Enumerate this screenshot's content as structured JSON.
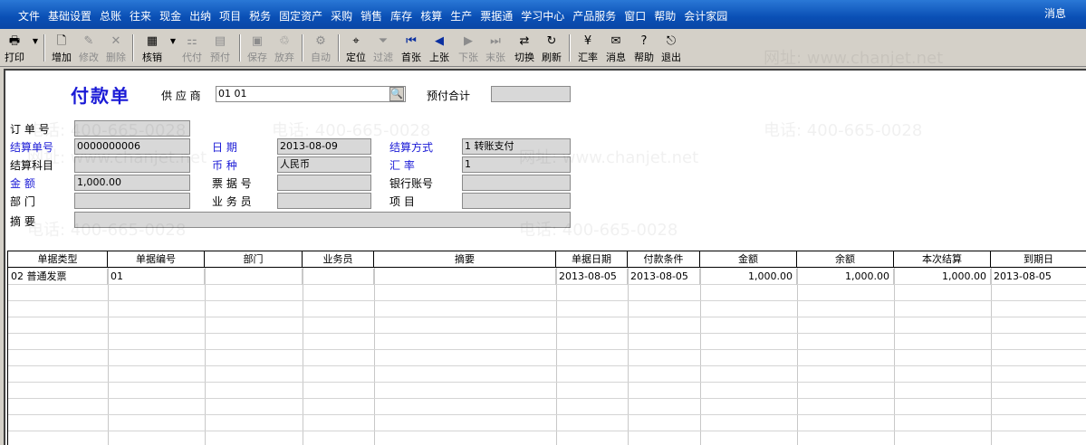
{
  "menubar": {
    "items": [
      "文件",
      "基础设置",
      "总账",
      "往来",
      "现金",
      "出纳",
      "项目",
      "税务",
      "固定资产",
      "采购",
      "销售",
      "库存",
      "核算",
      "生产",
      "票据通",
      "学习中心",
      "产品服务",
      "窗口",
      "帮助",
      "会计家园"
    ],
    "right_label": "消息"
  },
  "toolbar": {
    "print": "打印",
    "add": "增加",
    "edit": "修改",
    "delete": "删除",
    "verify": "核销",
    "proxy": "代付",
    "prepay": "预付",
    "save": "保存",
    "discard": "放弃",
    "auto": "自动",
    "locate": "定位",
    "filter": "过滤",
    "first": "首张",
    "prev": "上张",
    "next": "下张",
    "last": "末张",
    "switch": "切换",
    "refresh": "刷新",
    "rate": "汇率",
    "message": "消息",
    "help": "帮助",
    "exit": "退出"
  },
  "form": {
    "title": "付款单",
    "supplier_label": "供 应 商",
    "supplier_value": "01   01",
    "prepay_total_label": "预付合计",
    "order_no_label": "订 单 号",
    "settle_no_label": "结算单号",
    "settle_no_value": "0000000006",
    "date_label": "日    期",
    "date_value": "2013-08-09",
    "settle_method_label": "结算方式",
    "settle_method_value": "1   转账支付",
    "settle_subject_label": "结算科目",
    "currency_label": "币    种",
    "currency_value": "人民币",
    "exchange_rate_label": "汇    率",
    "exchange_rate_value": "1",
    "amount_label": "金    额",
    "amount_value": "1,000.00",
    "bill_no_label": "票 据 号",
    "bank_account_label": "银行账号",
    "dept_label": "部    门",
    "salesman_label": "业 务 员",
    "project_label": "项    目",
    "summary_label": "摘    要"
  },
  "grid": {
    "headers": [
      "单据类型",
      "单据编号",
      "部门",
      "业务员",
      "摘要",
      "单据日期",
      "付款条件",
      "金额",
      "余额",
      "本次结算",
      "到期日"
    ],
    "rows": [
      [
        "02   普通发票",
        "01",
        "",
        "",
        "",
        "2013-08-05",
        "2013-08-05",
        "1,000.00",
        "1,000.00",
        "1,000.00",
        "2013-08-05"
      ]
    ]
  },
  "watermark": {
    "phone": "电话: 400-665-0028",
    "site": "网址: www.chanjet.net"
  }
}
